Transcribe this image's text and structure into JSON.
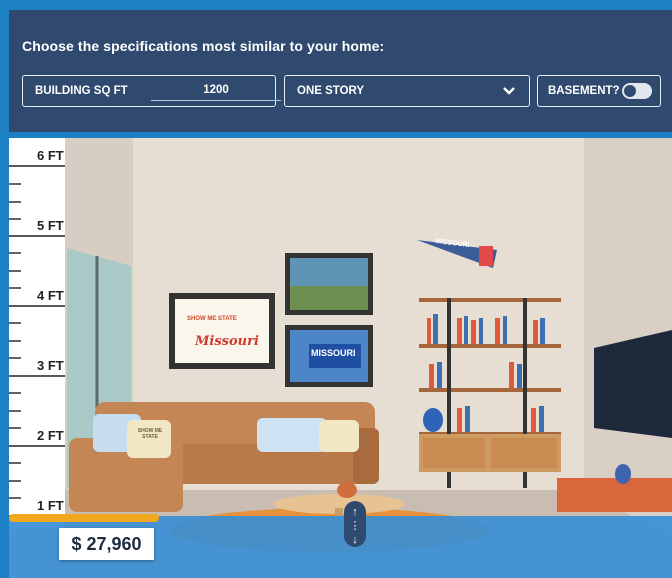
{
  "header": {
    "prompt": "Choose the specifications most similar to your home:"
  },
  "controls": {
    "sqft_label": "BUILDING SQ FT",
    "sqft_value": "1200",
    "story_selected": "ONE STORY",
    "basement_label": "BASEMENT?",
    "basement_on": false
  },
  "ruler": {
    "labels": [
      "6 FT",
      "5 FT",
      "4 FT",
      "3 FT",
      "2 FT",
      "1 FT"
    ]
  },
  "scene": {
    "poster_top": "SHOW ME STATE",
    "poster_main": "Missouri",
    "sign_text": "MISSOURI",
    "pennant_text": "MISSOURI",
    "pillow_text": "SHOW ME STATE"
  },
  "water_level": {
    "fraction_of_ruler": 0.1
  },
  "result": {
    "price": "$ 27,960"
  },
  "colors": {
    "panel": "#2f4a6e",
    "frame": "#1d7fc4",
    "water": "#3a8fd6",
    "marker": "#f3a71c"
  }
}
